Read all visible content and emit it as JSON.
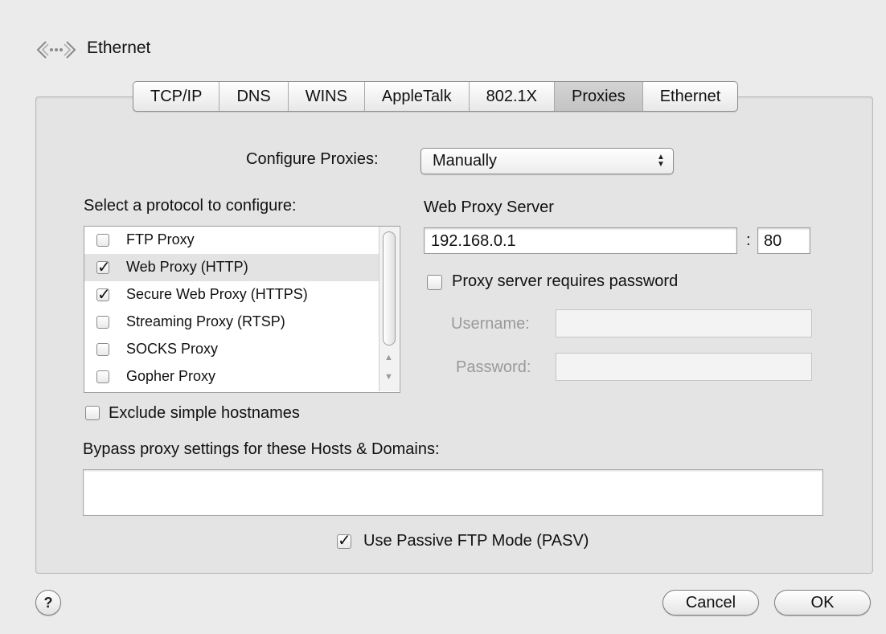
{
  "header": {
    "title": "Ethernet",
    "icon": "network-ethernet-icon"
  },
  "tabs": [
    {
      "label": "TCP/IP",
      "selected": false
    },
    {
      "label": "DNS",
      "selected": false
    },
    {
      "label": "WINS",
      "selected": false
    },
    {
      "label": "AppleTalk",
      "selected": false
    },
    {
      "label": "802.1X",
      "selected": false
    },
    {
      "label": "Proxies",
      "selected": true
    },
    {
      "label": "Ethernet",
      "selected": false
    }
  ],
  "configure": {
    "label": "Configure Proxies:",
    "value": "Manually"
  },
  "protocols": {
    "label": "Select a protocol to configure:",
    "items": [
      {
        "label": "FTP Proxy",
        "checked": false,
        "highlighted": false
      },
      {
        "label": "Web Proxy (HTTP)",
        "checked": true,
        "highlighted": true
      },
      {
        "label": "Secure Web Proxy (HTTPS)",
        "checked": true,
        "highlighted": false
      },
      {
        "label": "Streaming Proxy (RTSP)",
        "checked": false,
        "highlighted": false
      },
      {
        "label": "SOCKS Proxy",
        "checked": false,
        "highlighted": false
      },
      {
        "label": "Gopher Proxy",
        "checked": false,
        "highlighted": false
      }
    ]
  },
  "exclude": {
    "label": "Exclude simple hostnames",
    "checked": false
  },
  "bypass": {
    "label": "Bypass proxy settings for these Hosts & Domains:",
    "value": ""
  },
  "passive_ftp": {
    "label": "Use Passive FTP Mode (PASV)",
    "checked": true
  },
  "web_proxy": {
    "label": "Web Proxy Server",
    "host": "192.168.0.1",
    "separator": ":",
    "port": "80",
    "requires_password": {
      "label": "Proxy server requires password",
      "checked": false
    },
    "username_label": "Username:",
    "password_label": "Password:"
  },
  "footer": {
    "help": "?",
    "cancel": "Cancel",
    "ok": "OK"
  }
}
